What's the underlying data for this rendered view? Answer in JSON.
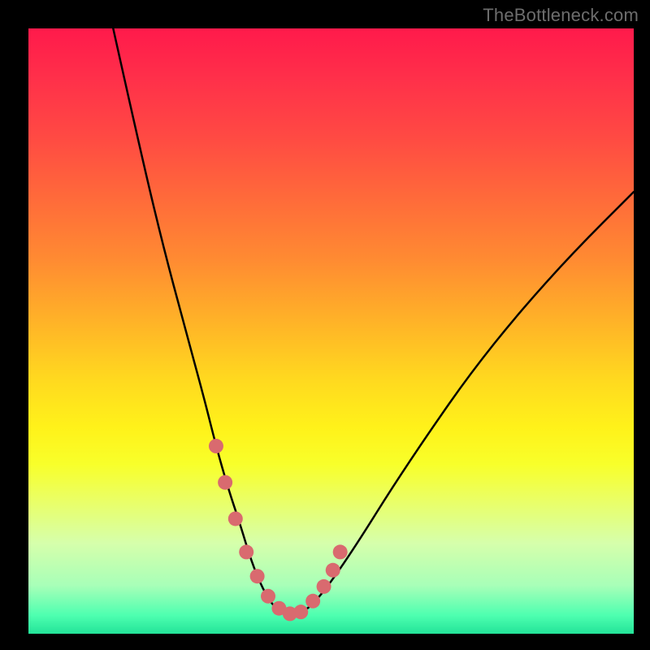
{
  "watermark": {
    "text": "TheBottleneck.com"
  },
  "colors": {
    "background": "#000000",
    "curve_stroke": "#000000",
    "marker_fill": "#d96a6f",
    "gradient_top": "#ff1a4b",
    "gradient_bottom": "#23e398"
  },
  "chart_data": {
    "type": "line",
    "title": "",
    "xlabel": "",
    "ylabel": "",
    "xlim": [
      0,
      100
    ],
    "ylim": [
      0,
      100
    ],
    "grid": false,
    "series": [
      {
        "name": "bottleneck-curve",
        "x": [
          14,
          18,
          22,
          26,
          29,
          31,
          33,
          35,
          36.5,
          38,
          39.5,
          41,
          42.5,
          44,
          46,
          48,
          51,
          55,
          60,
          66,
          73,
          81,
          90,
          100
        ],
        "values": [
          100,
          82,
          65,
          50,
          39,
          31,
          24,
          18,
          13,
          9,
          6,
          4,
          3,
          3,
          4,
          6,
          10,
          16,
          24,
          33,
          43,
          53,
          63,
          73
        ]
      }
    ],
    "markers": {
      "name": "highlight-dots",
      "x": [
        31,
        32.5,
        34.2,
        36.0,
        37.8,
        39.6,
        41.4,
        43.2,
        45.0,
        47.0,
        48.8,
        50.3,
        51.5
      ],
      "values": [
        31,
        25,
        19,
        13.5,
        9.5,
        6.2,
        4.2,
        3.3,
        3.6,
        5.4,
        7.8,
        10.5,
        13.5
      ]
    }
  }
}
